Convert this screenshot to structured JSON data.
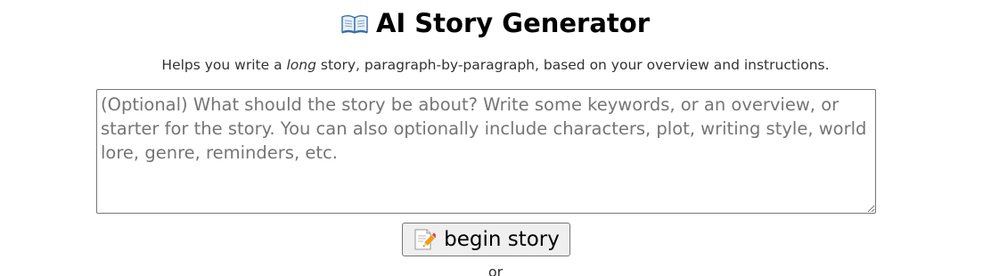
{
  "header": {
    "title": "AI Story Generator",
    "icon": "open-book-icon"
  },
  "subtitle": {
    "before": "Helps you write a ",
    "emphasis": "long",
    "after": " story, paragraph-by-paragraph, based on your overview and instructions."
  },
  "story_input": {
    "value": "",
    "placeholder": "(Optional) What should the story be about? Write some keywords, or an overview, or starter for the story. You can also optionally include characters, plot, writing style, world lore, genre, reminders, etc."
  },
  "begin_button": {
    "label": "begin story",
    "icon": "memo-icon"
  },
  "separator": {
    "text": "or"
  }
}
